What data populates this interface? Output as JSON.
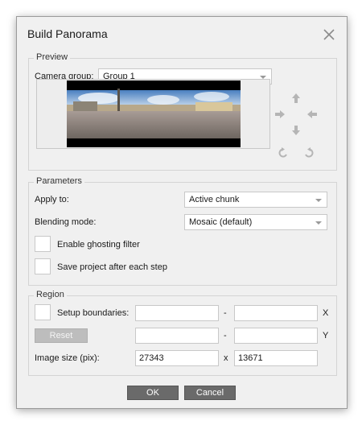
{
  "window": {
    "title": "Build Panorama"
  },
  "preview": {
    "group_title": "Preview",
    "camera_group_label": "Camera group:",
    "camera_group_value": "Group 1"
  },
  "parameters": {
    "group_title": "Parameters",
    "apply_to_label": "Apply to:",
    "apply_to_value": "Active chunk",
    "blending_label": "Blending mode:",
    "blending_value": "Mosaic (default)",
    "ghosting_label": "Enable ghosting filter",
    "save_label": "Save project after each step"
  },
  "region": {
    "group_title": "Region",
    "setup_label": "Setup boundaries:",
    "dash": "-",
    "x_label": "X",
    "y_label": "Y",
    "reset_label": "Reset",
    "image_size_label": "Image size (pix):",
    "width": "27343",
    "times": "x",
    "height": "13671"
  },
  "buttons": {
    "ok": "OK",
    "cancel": "Cancel"
  },
  "icons": {
    "close": "close-icon",
    "up": "arrow-up-icon",
    "down": "arrow-down-icon",
    "left": "arrow-left-icon",
    "right": "arrow-right-icon",
    "rotate_left": "rotate-left-icon",
    "rotate_right": "rotate-right-icon"
  },
  "colors": {
    "button": "#6a6a6a",
    "disabled_button": "#bdbdbd",
    "background": "#f0f0f0"
  }
}
